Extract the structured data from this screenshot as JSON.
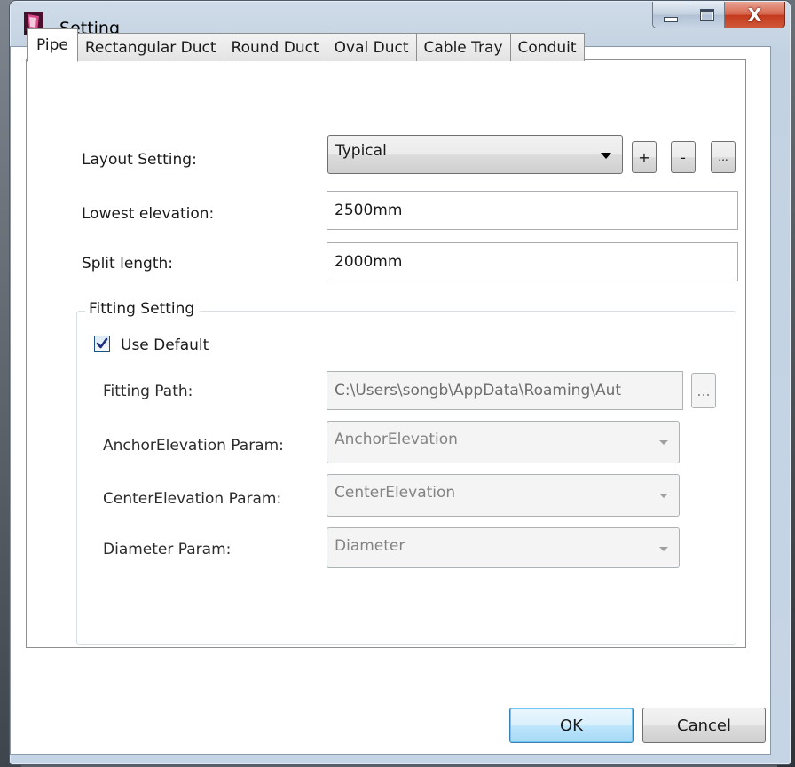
{
  "window": {
    "title": "Setting",
    "caption_buttons": {
      "minimize_icon": "minimize-icon",
      "maximize_icon": "maximize-icon",
      "close_glyph": "X"
    }
  },
  "tabs": [
    {
      "label": "Pipe",
      "active": true
    },
    {
      "label": "Rectangular Duct",
      "active": false
    },
    {
      "label": "Round Duct",
      "active": false
    },
    {
      "label": "Oval Duct",
      "active": false
    },
    {
      "label": "Cable Tray",
      "active": false
    },
    {
      "label": "Conduit",
      "active": false
    }
  ],
  "form": {
    "layout_setting_label": "Layout Setting:",
    "layout_setting_value": "Typical",
    "add_label": "+",
    "remove_label": "-",
    "more_label": "...",
    "lowest_elevation_label": "Lowest elevation:",
    "lowest_elevation_value": "2500mm",
    "split_length_label": "Split length:",
    "split_length_value": "2000mm"
  },
  "fitting": {
    "group_title": "Fitting Setting",
    "use_default_label": "Use Default",
    "use_default_checked": true,
    "fitting_path_label": "Fitting Path:",
    "fitting_path_value": "C:\\Users\\songb\\AppData\\Roaming\\Aut",
    "browse_label": "...",
    "anchor_elevation_label": "AnchorElevation Param:",
    "anchor_elevation_value": "AnchorElevation",
    "center_elevation_label": "CenterElevation Param:",
    "center_elevation_value": "CenterElevation",
    "diameter_label": "Diameter Param:",
    "diameter_value": "Diameter"
  },
  "footer": {
    "ok_label": "OK",
    "cancel_label": "Cancel"
  },
  "colors": {
    "title_bar": "#c6d5e5",
    "close_button": "#c3391c",
    "default_button": "#bee6fd",
    "checkbox_border": "#1c5180"
  }
}
